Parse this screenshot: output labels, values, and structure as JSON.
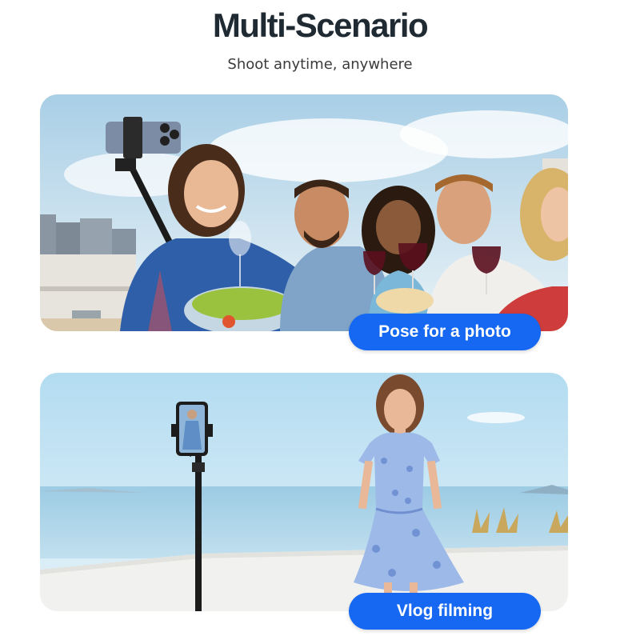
{
  "header": {
    "title": "Multi-Scenario",
    "subtitle": "Shoot anytime, anywhere"
  },
  "scenarios": [
    {
      "label": "Pose for a photo",
      "image_icon": "group-selfie-photo"
    },
    {
      "label": "Vlog filming",
      "image_icon": "selfie-stick-vlog-photo"
    }
  ],
  "colors": {
    "accent": "#1668f2",
    "title": "#1f2a33",
    "subtitle": "#3b3b3b"
  }
}
